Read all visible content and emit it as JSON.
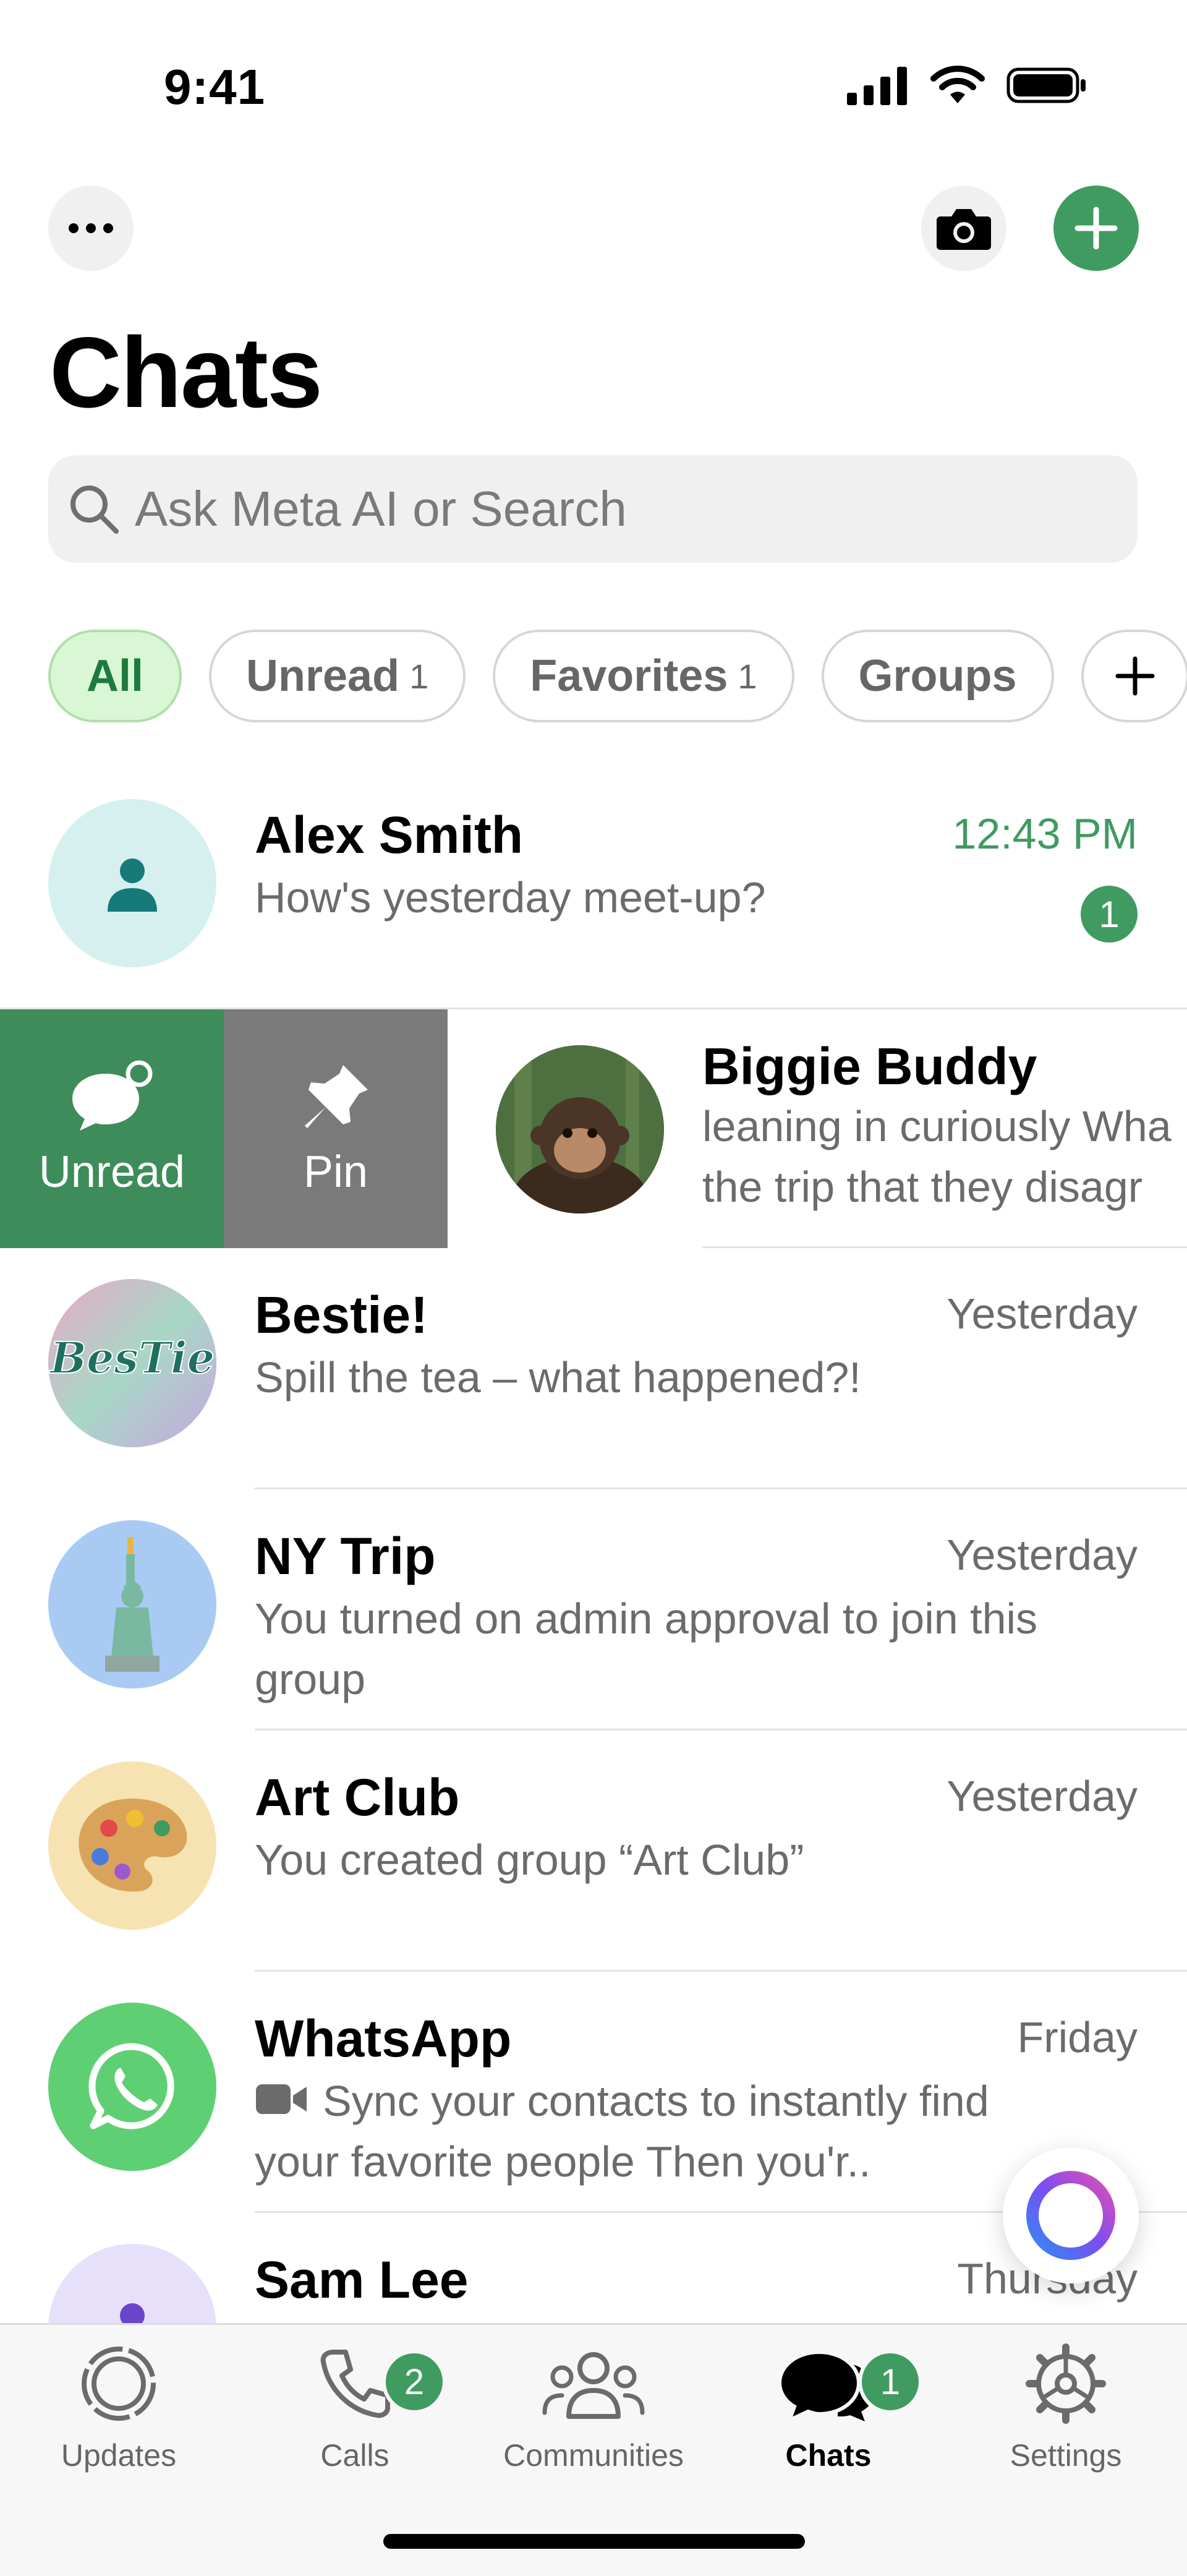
{
  "status_bar": {
    "time": "9:41"
  },
  "header": {
    "title": "Chats"
  },
  "search": {
    "placeholder": "Ask Meta AI or Search"
  },
  "filters": [
    {
      "label": "All",
      "count": ""
    },
    {
      "label": "Unread",
      "count": "1"
    },
    {
      "label": "Favorites",
      "count": "1"
    },
    {
      "label": "Groups",
      "count": ""
    },
    {
      "label": "+",
      "count": ""
    }
  ],
  "swipe_actions": {
    "unread_label": "Unread",
    "pin_label": "Pin"
  },
  "chats": [
    {
      "name": "Alex Smith",
      "preview": "How's yesterday meet-up?",
      "time": "12:43 PM",
      "unread": "1"
    },
    {
      "name": "Biggie Buddy",
      "preview_line1": "leaning in curiously Wha",
      "preview_line2": "the trip that they disagr"
    },
    {
      "name": "Bestie!",
      "preview": "Spill the tea – what happened?!",
      "time": "Yesterday"
    },
    {
      "name": "NY Trip",
      "preview": "You turned on admin approval to join this group",
      "time": "Yesterday"
    },
    {
      "name": "Art Club",
      "preview": "You created group “Art Club”",
      "time": "Yesterday"
    },
    {
      "name": "WhatsApp",
      "preview": "Sync your contacts to instantly find your favorite people Then you'r..",
      "time": "Friday"
    },
    {
      "name": "Sam Lee",
      "preview": "",
      "time": "Thursday"
    }
  ],
  "tabs": [
    {
      "label": "Updates",
      "badge": ""
    },
    {
      "label": "Calls",
      "badge": "2"
    },
    {
      "label": "Communities",
      "badge": ""
    },
    {
      "label": "Chats",
      "badge": "1"
    },
    {
      "label": "Settings",
      "badge": ""
    }
  ],
  "colors": {
    "accent": "#3f9b60",
    "chip_active_bg": "#d9f6d5",
    "pin_gray": "#7a7a7a"
  }
}
